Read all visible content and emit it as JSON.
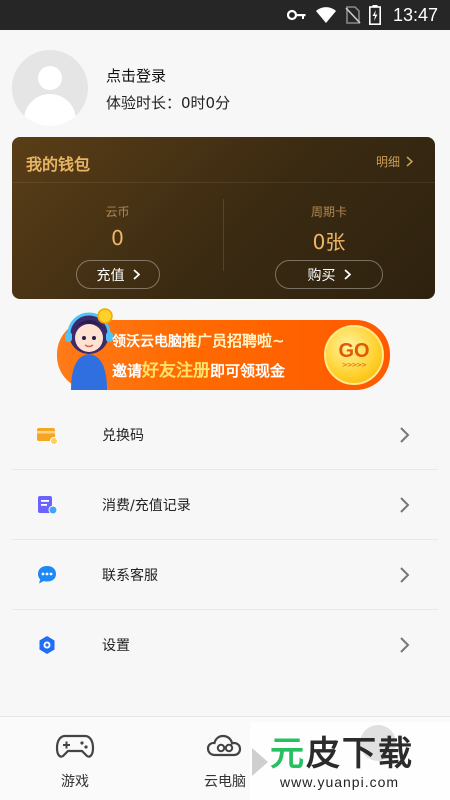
{
  "status_bar": {
    "time": "13:47",
    "icons": [
      "key-icon",
      "wifi-icon",
      "no-sim-icon",
      "battery-charging-icon"
    ]
  },
  "profile": {
    "login_text": "点击登录",
    "duration_text": "体验时长：0时0分"
  },
  "wallet": {
    "title": "我的钱包",
    "detail_label": "明细",
    "coins": {
      "label": "云币",
      "value": "0",
      "button_label": "充值"
    },
    "weekly_card": {
      "label": "周期卡",
      "value": "0张",
      "button_label": "购买"
    },
    "colors": {
      "background": "#3a2a12",
      "accent": "#f0b765"
    }
  },
  "banner": {
    "line1_part1": "领沃云电脑",
    "line1_part2": "推广员招聘啦~",
    "line2_part1": "邀请",
    "line2_part2": "好友注册",
    "line2_part3": "即可领现金",
    "go_label": "GO",
    "go_arrows": ">>>>>",
    "colors": {
      "background": "#ff6a00",
      "go_button": "#ffd02a"
    }
  },
  "menu": {
    "items": [
      {
        "label": "兑换码",
        "icon": "redeem-card-icon",
        "color": "#f5a623"
      },
      {
        "label": "消费/充值记录",
        "icon": "record-document-icon",
        "color": "#6c63ff"
      },
      {
        "label": "联系客服",
        "icon": "chat-bubble-icon",
        "color": "#1e88f5"
      },
      {
        "label": "设置",
        "icon": "settings-gear-icon",
        "color": "#1e6ff5"
      }
    ]
  },
  "tabbar": {
    "tabs": [
      {
        "label": "游戏",
        "icon": "gamepad-icon"
      },
      {
        "label": "云电脑",
        "icon": "cloud-icon"
      },
      {
        "label": "",
        "icon": "profile-avatar-icon"
      }
    ]
  },
  "watermark": {
    "title_part1": "元",
    "title_part2": "皮",
    "title_part3": "下载",
    "url": "www.yuanpi.com"
  }
}
